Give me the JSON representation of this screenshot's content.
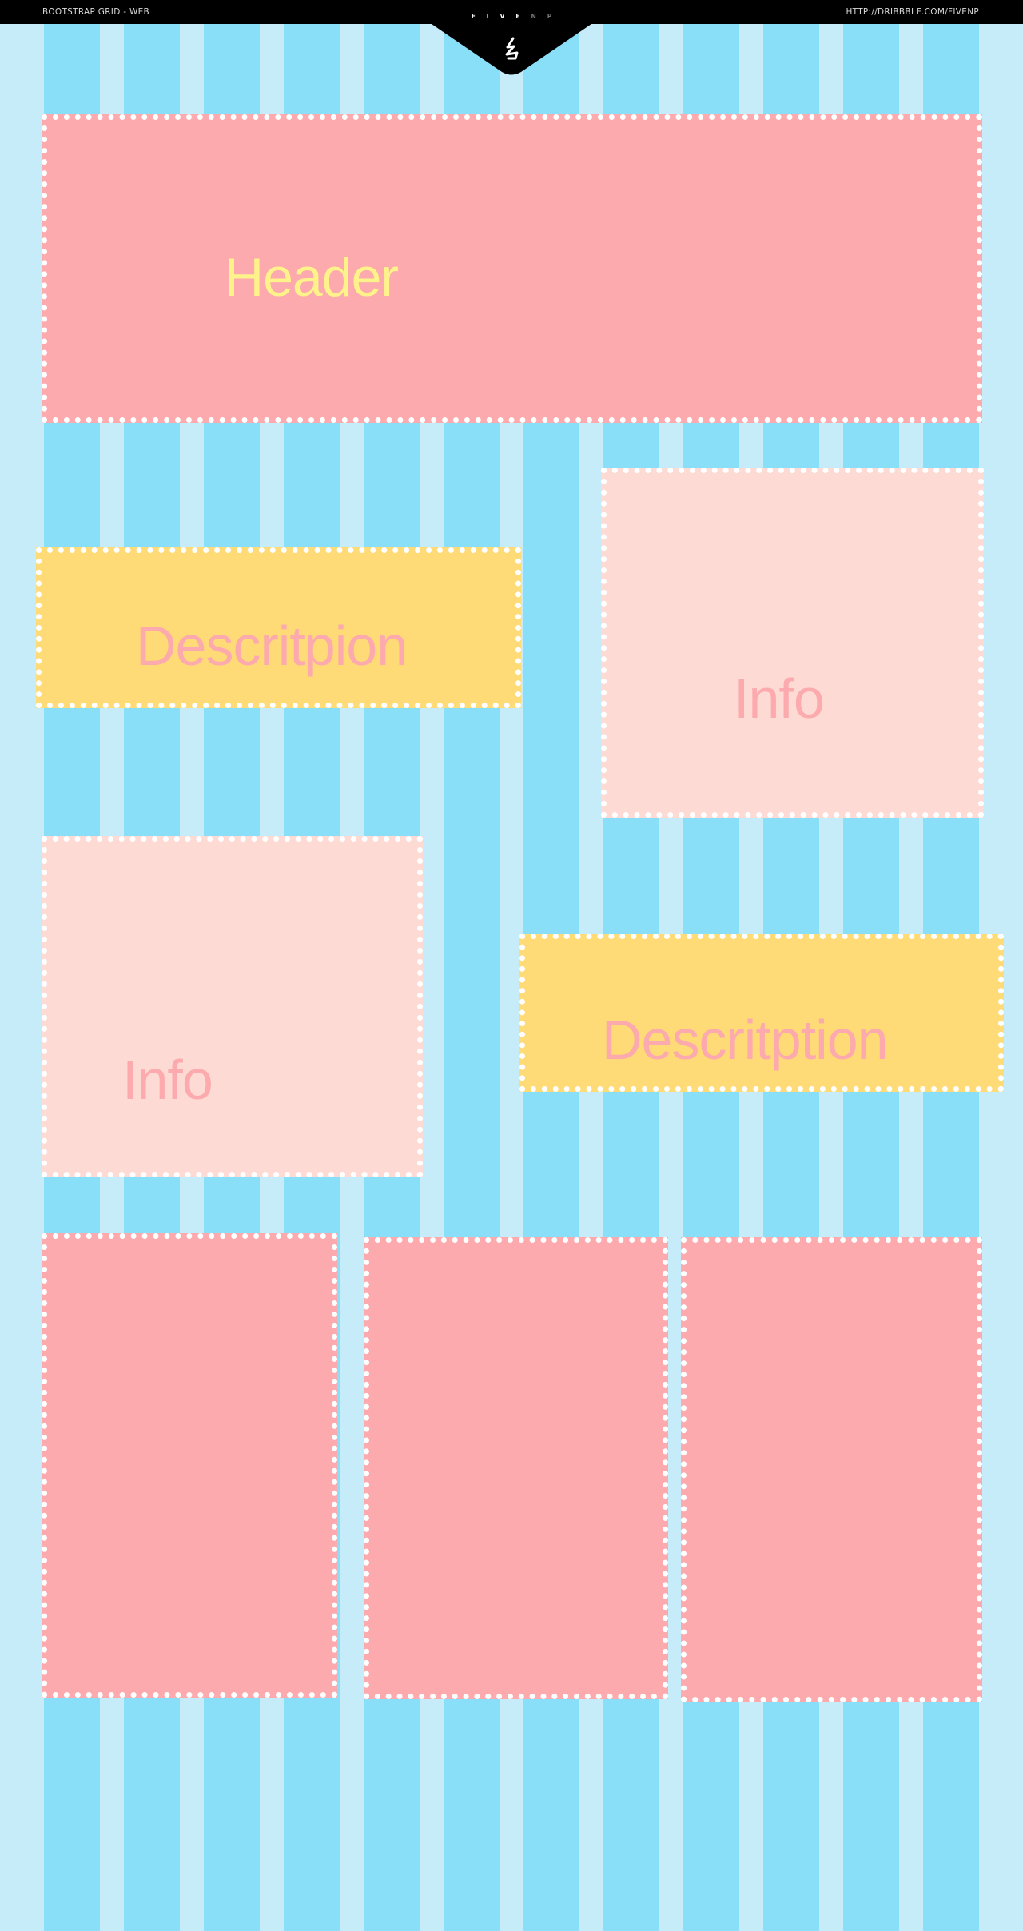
{
  "top_bar": {
    "left_label": "BOOTSTRAP GRID - WEB",
    "right_link": "HTTP://DRIBBBLE.COM/FIVENP",
    "brand_bright": "FIVE",
    "brand_dim": "NP",
    "brand_icon": "fivenp-logo-icon"
  },
  "grid": {
    "columns": 12,
    "column_color": "#89def8",
    "gutter_color": "#c6ecfa"
  },
  "blocks": {
    "header": {
      "label": "Header",
      "color": "#fcaaad",
      "label_color": "#fef38a"
    },
    "description_left": {
      "label": "Descritpion",
      "color": "#fedb76",
      "label_color": "#fcaaad"
    },
    "info_right": {
      "label": "Info",
      "color": "#fddad3",
      "label_color": "#fcaaad"
    },
    "info_left": {
      "label": "Info",
      "color": "#fddad3",
      "label_color": "#fcaaad"
    },
    "description_right": {
      "label": "Descritption",
      "color": "#fedb76",
      "label_color": "#fcaaad"
    },
    "bottom_blocks": [
      {
        "label": "",
        "color": "#fcaaad"
      },
      {
        "label": "",
        "color": "#fcaaad"
      },
      {
        "label": "",
        "color": "#fcaaad"
      }
    ]
  }
}
